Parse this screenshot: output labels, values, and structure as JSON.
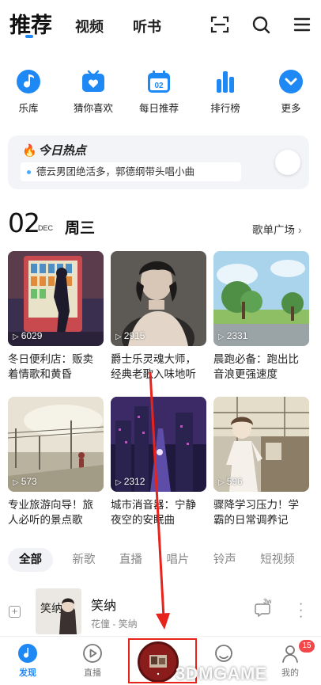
{
  "top_tabs": {
    "recommend": "推荐",
    "video": "视频",
    "audiobook": "听书"
  },
  "quick_entries": [
    {
      "label": "乐库",
      "icon": "music-note-icon"
    },
    {
      "label": "猜你喜欢",
      "icon": "heart-tv-icon"
    },
    {
      "label": "每日推荐",
      "icon": "calendar-icon",
      "badge": "02"
    },
    {
      "label": "排行榜",
      "icon": "bar-chart-icon"
    },
    {
      "label": "更多",
      "icon": "chevron-down-icon"
    }
  ],
  "hot_today": {
    "title": "今日热点",
    "headline": "德云男团绝活多，郭德纲带头唱小曲"
  },
  "date_header": {
    "day": "02",
    "month": "DEC",
    "weekday": "周三",
    "more_label": "歌单广场"
  },
  "playlists": [
    {
      "plays": "6029",
      "title": "冬日便利店：贩卖着情歌和黄昏"
    },
    {
      "plays": "2915",
      "title": "爵士乐灵魂大师，经典老歌入味地听"
    },
    {
      "plays": "2331",
      "title": "晨跑必备：跑出比音浪更强速度"
    },
    {
      "plays": "573",
      "title": "专业旅游向导！旅人必听的景点歌"
    },
    {
      "plays": "2312",
      "title": "城市消音器：宁静夜空的安眠曲"
    },
    {
      "plays": "596",
      "title": "骤降学习压力！学霸的日常调养记"
    }
  ],
  "categories": [
    "全部",
    "新歌",
    "直播",
    "唱片",
    "铃声",
    "短视频"
  ],
  "song": {
    "name": "笑纳",
    "artist": "花僮 - 笑纳",
    "comment_count": "3w",
    "cover_text": "笑纳"
  },
  "bottom_nav": [
    {
      "label": "发现",
      "active": true
    },
    {
      "label": "直播",
      "active": false
    },
    {
      "label": "",
      "active": false
    },
    {
      "label": "",
      "active": false
    },
    {
      "label": "我的",
      "active": false
    }
  ],
  "notification_badge": "15",
  "watermark": "3DMGAME",
  "colors": {
    "accent": "#1e88f5",
    "annotation": "#e8231b",
    "badge": "#f3484a",
    "fire": "#f24a2e"
  }
}
